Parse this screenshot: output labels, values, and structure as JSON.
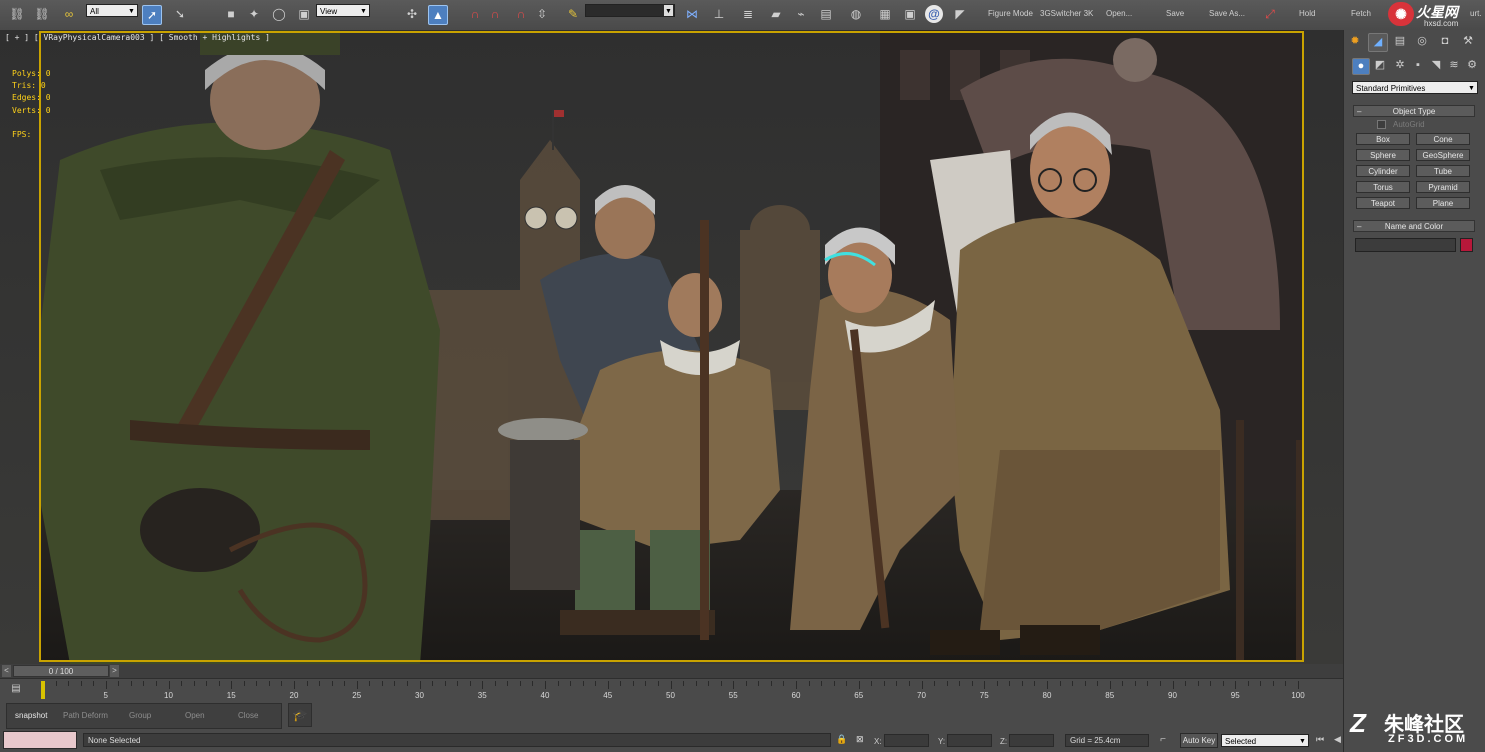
{
  "toolbar": {
    "selection_filter": "All",
    "ref_coord": "View",
    "named_selection": "",
    "menu": [
      "Figure Mode",
      "3GSwitcher 3K",
      "Open...",
      "Save",
      "Save As...",
      "Hold",
      "Fetch"
    ],
    "right_text": "urt."
  },
  "viewport": {
    "label": "[ + ] [ VRayPhysicalCamera003 ] [ Smooth + Highlights ]",
    "stats": [
      {
        "name": "Polys:",
        "value": "0"
      },
      {
        "name": "Tris:",
        "value": "0"
      },
      {
        "name": "Edges:",
        "value": "0"
      },
      {
        "name": "Verts:",
        "value": "0"
      }
    ],
    "fps_label": "FPS:"
  },
  "command_panel": {
    "category_dropdown": "Standard Primitives",
    "object_type_title": "Object Type",
    "autogrid_label": "AutoGrid",
    "primitives": [
      "Box",
      "Cone",
      "Sphere",
      "GeoSphere",
      "Cylinder",
      "Tube",
      "Torus",
      "Pyramid",
      "Teapot",
      "Plane"
    ],
    "name_color_title": "Name and Color",
    "object_color": "#b8183a"
  },
  "timeline": {
    "frame_counter": "0 / 100",
    "ticks": [
      "0",
      "5",
      "10",
      "15",
      "20",
      "25",
      "30",
      "35",
      "40",
      "45",
      "50",
      "55",
      "60",
      "65",
      "70",
      "75",
      "80",
      "85",
      "90",
      "95",
      "100"
    ]
  },
  "bottom_bar": {
    "tools": [
      "snapshot",
      "Path Deform",
      "Group",
      "Open",
      "Close"
    ],
    "status": "None Selected",
    "x_label": "X:",
    "y_label": "Y:",
    "z_label": "Z:",
    "grid": "Grid = 25.4cm",
    "auto_key": "Auto Key",
    "key_mode": "Selected"
  },
  "watermarks": {
    "top_brand": "火星网",
    "top_url": "hxsd.com",
    "bottom_brand": "朱峰社区",
    "bottom_url": "ZF3D.COM"
  },
  "colors": {
    "viewport_border": "#c9a300",
    "stats_text": "#ffd21a",
    "active_blue": "#4d7fbf"
  }
}
